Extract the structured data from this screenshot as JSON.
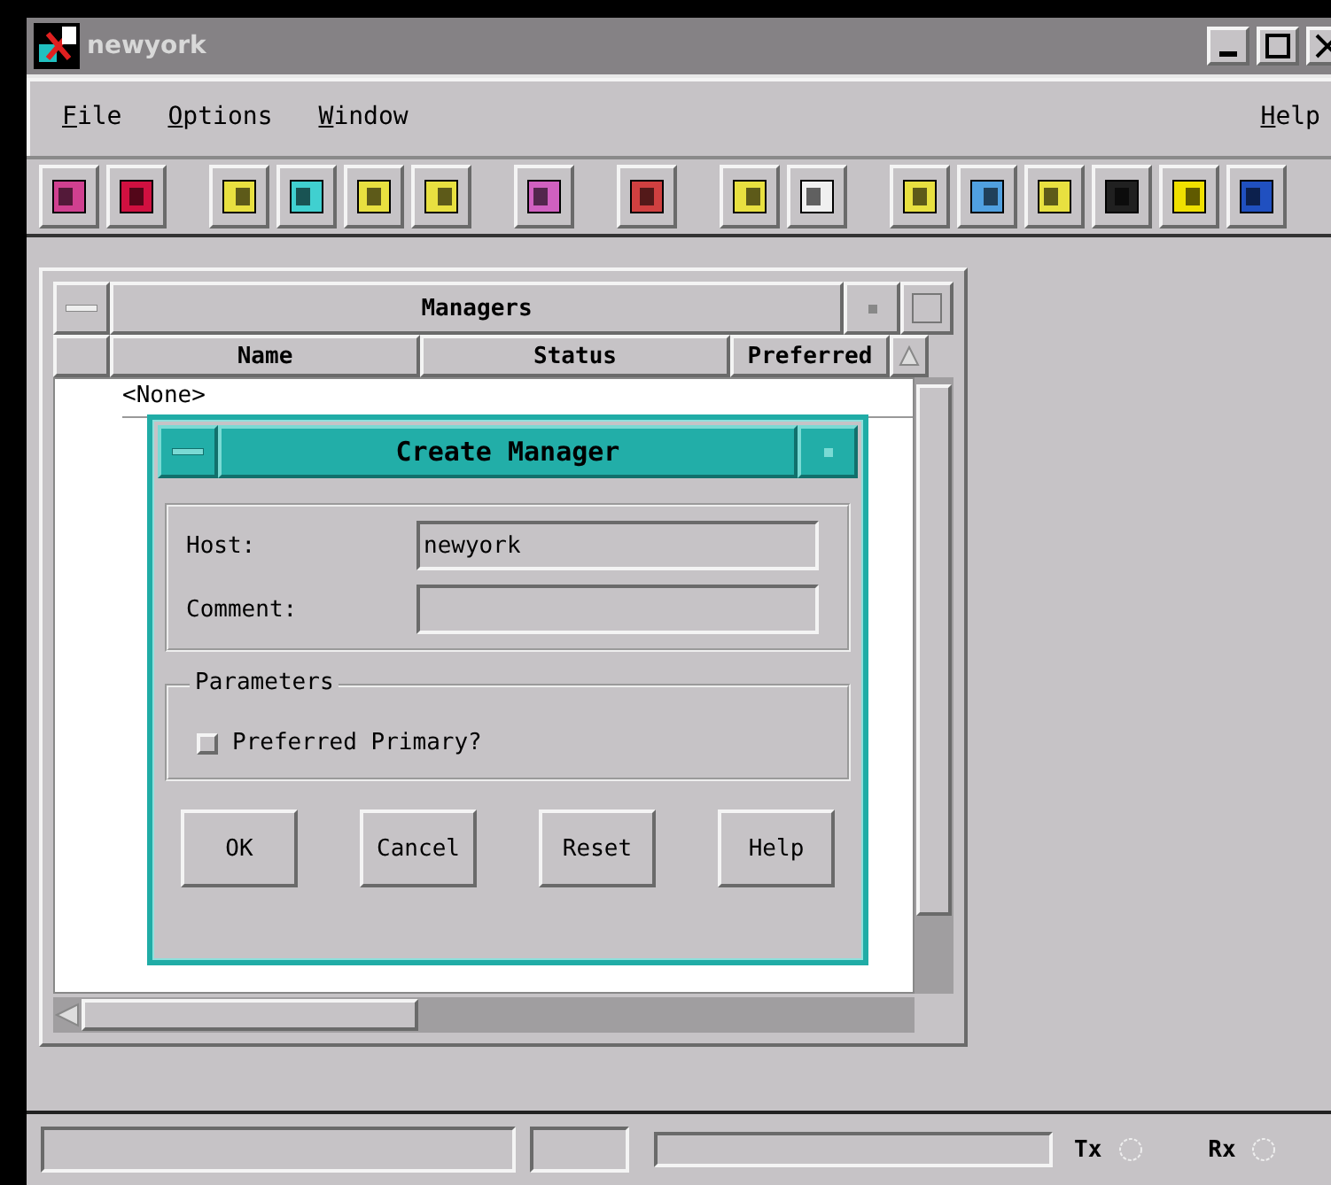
{
  "window": {
    "title": "newyork"
  },
  "menu": [
    {
      "label": "File"
    },
    {
      "label": "Options"
    },
    {
      "label": "Window"
    },
    {
      "label": "Help"
    }
  ],
  "managers": {
    "title": "Managers",
    "columns": [
      "Name",
      "Status",
      "Preferred"
    ],
    "rows": [
      "<None>"
    ]
  },
  "dialog": {
    "title": "Create Manager",
    "fields": [
      {
        "label": "Host:",
        "value": "newyork"
      },
      {
        "label": "Comment:"
      }
    ],
    "parameters": {
      "title": "Parameters",
      "options": [
        {
          "label": "Preferred Primary?",
          "checked": false
        }
      ]
    },
    "buttons": [
      "OK",
      "Cancel",
      "Reset",
      "Help"
    ]
  },
  "status_bar": {
    "indicators": [
      {
        "label": "Tx",
        "on": false
      },
      {
        "label": "Rx",
        "on": false
      }
    ]
  }
}
